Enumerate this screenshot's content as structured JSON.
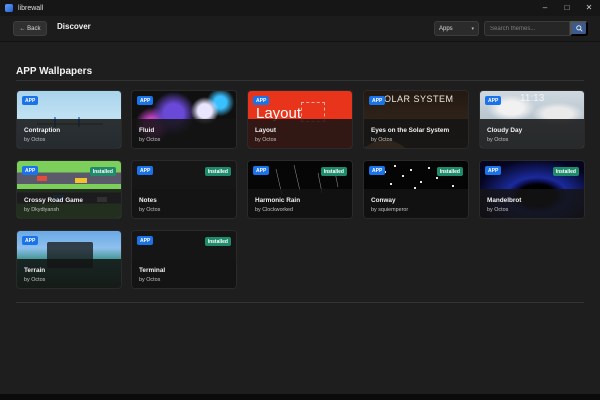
{
  "window": {
    "title": "librewall",
    "minimize": "–",
    "maximize": "□",
    "close": "✕"
  },
  "toolbar": {
    "back_label": "← Back",
    "page_title": "Discover",
    "filter": {
      "selected": "Apps",
      "caret": "▾"
    },
    "search": {
      "placeholder": "Search themes..."
    }
  },
  "section": {
    "title": "APP Wallpapers"
  },
  "cards": [
    {
      "title": "Contraption",
      "author": "by Octos",
      "badge": "APP",
      "installed": ""
    },
    {
      "title": "Fluid",
      "author": "by Octos",
      "badge": "APP",
      "installed": ""
    },
    {
      "title": "Layout",
      "author": "by Octos",
      "badge": "APP",
      "installed": "",
      "thumb_text": "Layout"
    },
    {
      "title": "Eyes on the Solar System",
      "author": "by Octos",
      "badge": "APP",
      "installed": "",
      "thumb_text": "OLAR SYSTEM"
    },
    {
      "title": "Cloudy Day",
      "author": "by Octos",
      "badge": "APP",
      "installed": "",
      "thumb_text": "11:13"
    },
    {
      "title": "Crossy Road Game",
      "author": "by Dkydiyansh",
      "badge": "APP",
      "installed": "Installed"
    },
    {
      "title": "Notes",
      "author": "by Octos",
      "badge": "APP",
      "installed": "Installed"
    },
    {
      "title": "Harmonic Rain",
      "author": "by Clockworked",
      "badge": "APP",
      "installed": "Installed"
    },
    {
      "title": "Conway",
      "author": "by squiemperor",
      "badge": "APP",
      "installed": "Installed"
    },
    {
      "title": "Mandelbrot",
      "author": "by Octos",
      "badge": "APP",
      "installed": "Installed"
    },
    {
      "title": "Terrain",
      "author": "by Octos",
      "badge": "APP",
      "installed": ""
    },
    {
      "title": "Terminal",
      "author": "by Octos",
      "badge": "APP",
      "installed": "Installed"
    }
  ],
  "icons": {
    "back": "arrow-left-icon",
    "search": "search-icon",
    "app": "app-logo-icon"
  },
  "colors": {
    "accent": "#1a73e8",
    "installed": "#1f8b6a",
    "background": "#1e1e1e"
  }
}
